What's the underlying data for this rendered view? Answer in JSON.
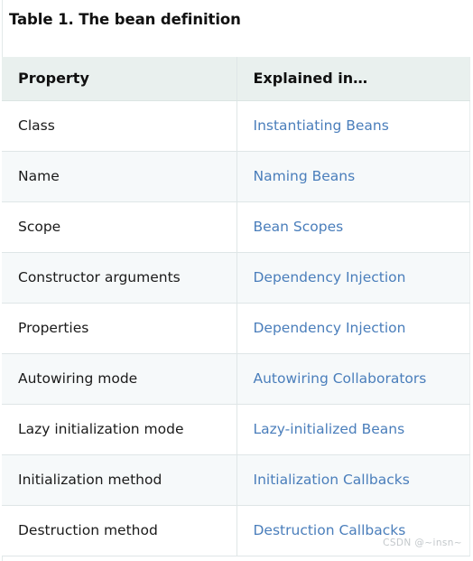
{
  "document": {
    "title": "Table 1. The bean definition"
  },
  "table": {
    "headers": {
      "property": "Property",
      "explained_in": "Explained in…"
    },
    "rows": [
      {
        "property": "Class",
        "link": "Instantiating Beans"
      },
      {
        "property": "Name",
        "link": "Naming Beans"
      },
      {
        "property": "Scope",
        "link": "Bean Scopes"
      },
      {
        "property": "Constructor arguments",
        "link": "Dependency Injection"
      },
      {
        "property": "Properties",
        "link": "Dependency Injection"
      },
      {
        "property": "Autowiring mode",
        "link": "Autowiring Collaborators"
      },
      {
        "property": "Lazy initialization mode",
        "link": "Lazy-initialized Beans"
      },
      {
        "property": "Initialization method",
        "link": "Initialization Callbacks"
      },
      {
        "property": "Destruction method",
        "link": "Destruction Callbacks"
      }
    ]
  },
  "watermark": {
    "text": "CSDN @~insn~"
  },
  "colors": {
    "link": "#4a7ebb",
    "header_background": "#e9f0ee",
    "row_alt_background": "#f6f9fa",
    "border": "#dfe6e7",
    "text": "#1a1a1a",
    "watermark": "#c3c8cb"
  }
}
